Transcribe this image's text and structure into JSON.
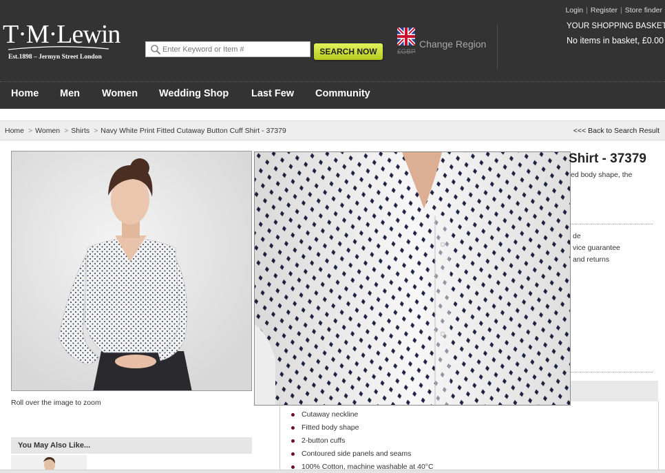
{
  "header": {
    "logo_main": "T·M·Lewin",
    "logo_sub": "Est.1898 – Jermyn Street London",
    "top_links": [
      "Login",
      "Register",
      "Store finder"
    ],
    "search": {
      "placeholder": "Enter Keyword or Item #",
      "button_label": "SEARCH NOW"
    },
    "region": {
      "currency": "£GBP",
      "label": "Change Region"
    },
    "basket": {
      "title": "YOUR SHOPPING BASKET",
      "status": "No items in basket, £0.00"
    }
  },
  "nav": {
    "items": [
      "Home",
      "Men",
      "Women",
      "Wedding Shop",
      "Last Few",
      "Community"
    ]
  },
  "breadcrumb": {
    "items": [
      "Home",
      "Women",
      "Shirts",
      "Navy White Print Fitted Cutaway Button Cuff Shirt - 37379"
    ],
    "back_link": "<<< Back to Search Result"
  },
  "product": {
    "title_fragment": "Shirt - 37379",
    "description_fragment": "ed body shape, the",
    "info_fragments": [
      "de",
      "vice guarantee",
      "and returns"
    ],
    "zoom_hint": "Roll over the image to zoom",
    "features": [
      "Cutaway neckline",
      "Fitted body shape",
      "2-button cuffs",
      "Contoured side panels and seams",
      "100% Cotton, machine washable at 40°C"
    ]
  },
  "you_may_also_like": {
    "title": "You May Also Like..."
  },
  "colors": {
    "header_bg": "#333333",
    "search_button": "#c6dc2c",
    "bullet": "#6b0f2a",
    "breadcrumb_bg": "#eeeeee",
    "print_navy": "#1f2444"
  },
  "icons": [
    "search-icon",
    "uk-flag-icon",
    "bullet-icon"
  ]
}
